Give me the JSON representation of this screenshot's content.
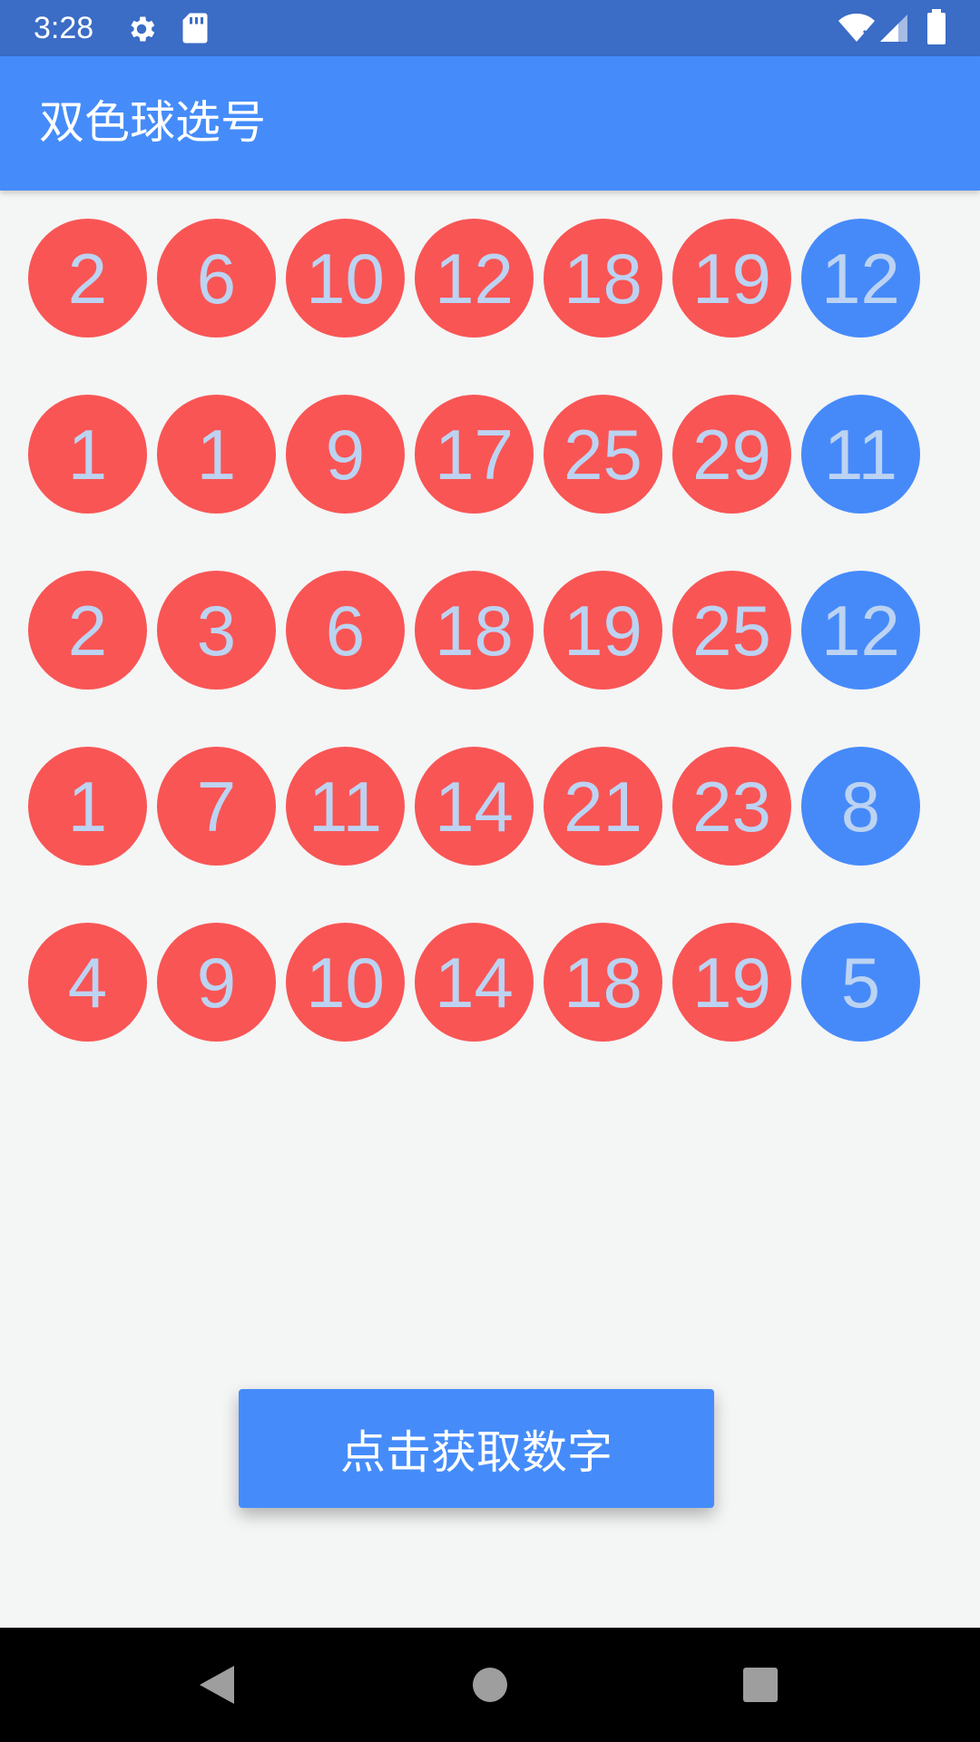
{
  "status_bar": {
    "time": "3:28",
    "icons": [
      "gear-icon",
      "sd-card-icon",
      "wifi-icon",
      "signal-icon",
      "battery-icon"
    ]
  },
  "app_bar": {
    "title": "双色球选号"
  },
  "ball_rows": [
    {
      "red": [
        "2",
        "6",
        "10",
        "12",
        "18",
        "19"
      ],
      "blue": "12"
    },
    {
      "red": [
        "1",
        "1",
        "9",
        "17",
        "25",
        "29"
      ],
      "blue": "11"
    },
    {
      "red": [
        "2",
        "3",
        "6",
        "18",
        "19",
        "25"
      ],
      "blue": "12"
    },
    {
      "red": [
        "1",
        "7",
        "11",
        "14",
        "21",
        "23"
      ],
      "blue": "8"
    },
    {
      "red": [
        "4",
        "9",
        "10",
        "14",
        "18",
        "19"
      ],
      "blue": "5"
    }
  ],
  "button": {
    "label": "点击获取数字"
  },
  "nav_bar": {
    "icons": [
      "back-icon",
      "home-icon",
      "recents-icon"
    ]
  },
  "colors": {
    "status_bar": "#3b6cc6",
    "app_bar": "#458cfa",
    "red_ball": "#f95555",
    "blue_ball": "#468af9",
    "ball_text": "#bcd3f2",
    "background": "#f4f5f5"
  }
}
